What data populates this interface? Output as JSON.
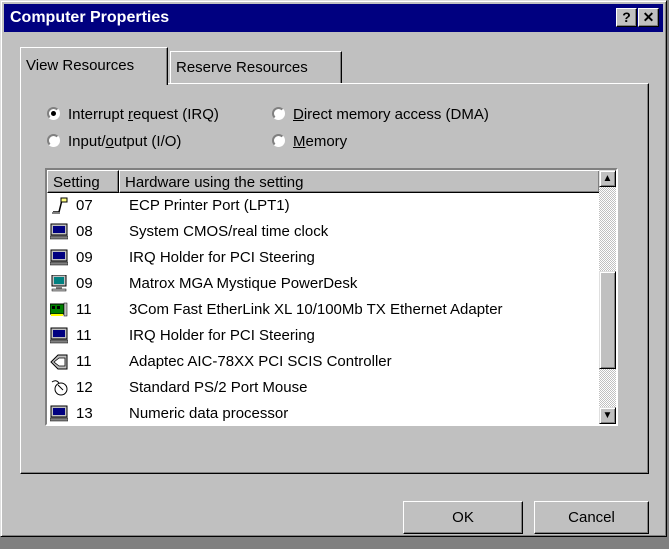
{
  "window": {
    "title": "Computer Properties",
    "help_label": "?",
    "close_label": "✕"
  },
  "tabs": [
    {
      "label": "View Resources",
      "active": true
    },
    {
      "label": "Reserve Resources",
      "active": false
    }
  ],
  "radios": [
    {
      "pre": "Interrupt ",
      "accel": "r",
      "post": "equest (IRQ)",
      "checked": true
    },
    {
      "pre": "Input/",
      "accel": "o",
      "post": "utput (I/O)",
      "checked": false
    },
    {
      "pre": "",
      "accel": "D",
      "post": "irect memory access (DMA)",
      "checked": false
    },
    {
      "pre": "",
      "accel": "M",
      "post": "emory",
      "checked": false
    }
  ],
  "list": {
    "columns": [
      "Setting",
      "Hardware using the setting"
    ],
    "rows": [
      {
        "icon": "printer-icon",
        "setting": "07",
        "hardware": "ECP Printer Port (LPT1)"
      },
      {
        "icon": "computer-icon",
        "setting": "08",
        "hardware": "System CMOS/real time clock"
      },
      {
        "icon": "computer-icon",
        "setting": "09",
        "hardware": "IRQ Holder for PCI Steering"
      },
      {
        "icon": "monitor-icon",
        "setting": "09",
        "hardware": "Matrox MGA Mystique PowerDesk"
      },
      {
        "icon": "network-card-icon",
        "setting": "11",
        "hardware": "3Com Fast EtherLink XL 10/100Mb TX Ethernet Adapter"
      },
      {
        "icon": "computer-icon",
        "setting": "11",
        "hardware": "IRQ Holder for PCI Steering"
      },
      {
        "icon": "scsi-controller-icon",
        "setting": "11",
        "hardware": "Adaptec AIC-78XX PCI SCIS Controller"
      },
      {
        "icon": "mouse-icon",
        "setting": "12",
        "hardware": "Standard PS/2 Port Mouse"
      },
      {
        "icon": "computer-icon",
        "setting": "13",
        "hardware": "Numeric data processor"
      }
    ]
  },
  "buttons": {
    "ok": "OK",
    "cancel": "Cancel"
  }
}
